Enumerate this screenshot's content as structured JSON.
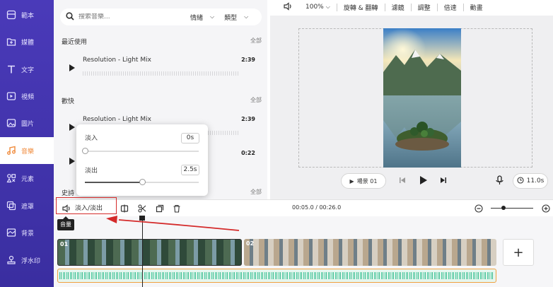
{
  "sidebar": {
    "items": [
      {
        "label": "範本",
        "icon": "template-icon"
      },
      {
        "label": "媒體",
        "icon": "media-icon"
      },
      {
        "label": "文字",
        "icon": "text-icon"
      },
      {
        "label": "視頻",
        "icon": "video-icon"
      },
      {
        "label": "圖片",
        "icon": "image-icon"
      },
      {
        "label": "音樂",
        "icon": "music-icon"
      },
      {
        "label": "元素",
        "icon": "elements-icon"
      },
      {
        "label": "遮罩",
        "icon": "overlay-icon"
      },
      {
        "label": "背景",
        "icon": "background-icon"
      },
      {
        "label": "浮水印",
        "icon": "watermark-icon"
      }
    ],
    "active_index": 5
  },
  "library": {
    "search_placeholder": "搜索音樂...",
    "filter_mood": "情緒",
    "filter_genre": "類型",
    "sections": [
      {
        "title": "最近使用",
        "all_label": "全部",
        "tracks": [
          {
            "name": "Resolution - Light Mix",
            "duration": "2:39"
          }
        ]
      },
      {
        "title": "歡快",
        "all_label": "全部",
        "tracks": [
          {
            "name": "Resolution - Light Mix",
            "duration": "2:39"
          },
          {
            "name": "",
            "duration": "0:22"
          }
        ]
      },
      {
        "title": "史詩",
        "all_label": "全部",
        "tracks": []
      }
    ]
  },
  "fade_popup": {
    "fade_in_label": "淡入",
    "fade_in_value": "0s",
    "fade_in_fraction": 0.0,
    "fade_out_label": "淡出",
    "fade_out_value": "2.5s",
    "fade_out_fraction": 0.5
  },
  "toolbar": {
    "zoom": "100%",
    "items": [
      "旋轉 & 翻轉",
      "濾鏡",
      "調整",
      "倍速",
      "動畫"
    ]
  },
  "player": {
    "scene_label": "場景 01",
    "duration": "11.0s"
  },
  "timeline": {
    "fade_label": "淡入/淡出",
    "current_time": "00:05.0",
    "total_time": "00:26.0",
    "tooltip": "音量",
    "clips": [
      {
        "index": "01"
      },
      {
        "index": "02"
      }
    ],
    "add_label": "+",
    "zoom_fraction": 0.3
  },
  "colors": {
    "sidebar": "#4a3ab9",
    "active": "#f08a3a",
    "audio_track": "#3ec99b",
    "highlight": "#d42a2a"
  }
}
